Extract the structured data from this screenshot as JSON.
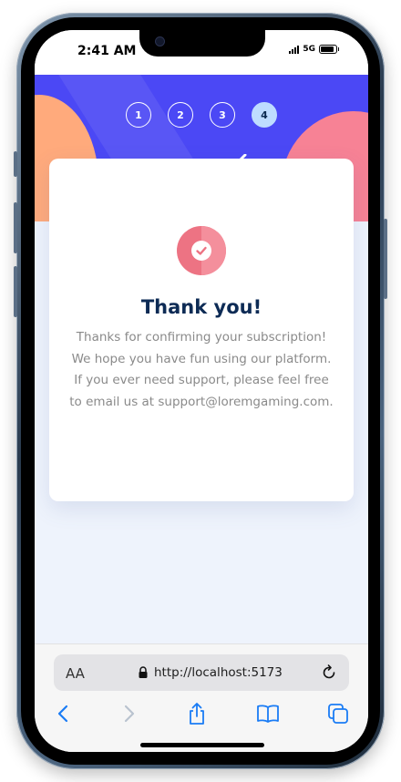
{
  "status_bar": {
    "time": "2:41 AM",
    "network": "5G",
    "icons": [
      "signal-icon",
      "battery-icon"
    ]
  },
  "stepper": {
    "steps": [
      "1",
      "2",
      "3",
      "4"
    ],
    "active_step": "4"
  },
  "confirmation": {
    "icon": "check-circle-icon",
    "title": "Thank you!",
    "message": "Thanks for confirming your subscription! We hope you have fun using our platform. If you ever need support, please feel free to email us at support@loremgaming.com."
  },
  "browser": {
    "text_size_label": "AA",
    "url": "http://localhost:5173",
    "toolbar_icons": [
      "back-icon",
      "forward-icon",
      "share-icon",
      "bookmarks-icon",
      "tabs-icon"
    ]
  },
  "colors": {
    "hero_background": "#4b48f5",
    "blob_left": "#ffaa7c",
    "blob_right": "#f78295",
    "title": "#0d2b55",
    "active_step": "#bedcff",
    "check_icon": "#ed7383",
    "ios_blue": "#1a7cf5"
  }
}
